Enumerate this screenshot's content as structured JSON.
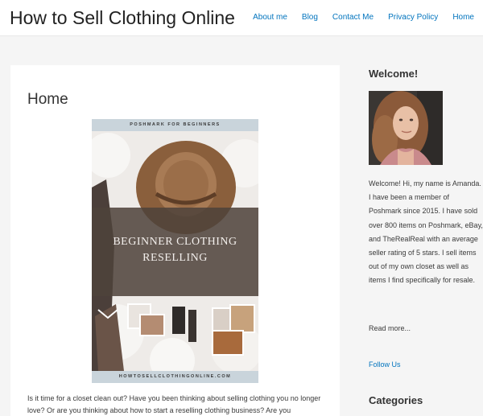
{
  "site": {
    "title": "How to Sell Clothing Online"
  },
  "nav": {
    "items": [
      {
        "label": "About me"
      },
      {
        "label": "Blog"
      },
      {
        "label": "Contact Me"
      },
      {
        "label": "Privacy Policy"
      },
      {
        "label": "Home"
      }
    ]
  },
  "main": {
    "page_title": "Home",
    "featured": {
      "top_label": "POSHMARK FOR BEGINNERS",
      "headline_line1": "BEGINNER CLOTHING",
      "headline_line2": "RESELLING",
      "bottom_label": "HOWTOSELLCLOTHINGONLINE.COM"
    },
    "intro": "Is it time for a closet clean out? Have you been thinking about selling clothing you no longer love? Or are you thinking about how to start a reselling clothing business? Are you"
  },
  "sidebar": {
    "welcome_title": "Welcome!",
    "bio": "Welcome! Hi, my name is Amanda. I have been a member of Poshmark since 2015. I have sold over 800 items on Poshmark, eBay, and TheRealReal with an average seller rating of 5 stars. I sell items out of my own closet as well as items I find specifically for resale.",
    "read_more": "Read more...",
    "follow_us": "Follow Us",
    "categories_title": "Categories"
  },
  "colors": {
    "link": "#0274be",
    "band": "#4e423a",
    "label_strip": "#c9d4db"
  }
}
